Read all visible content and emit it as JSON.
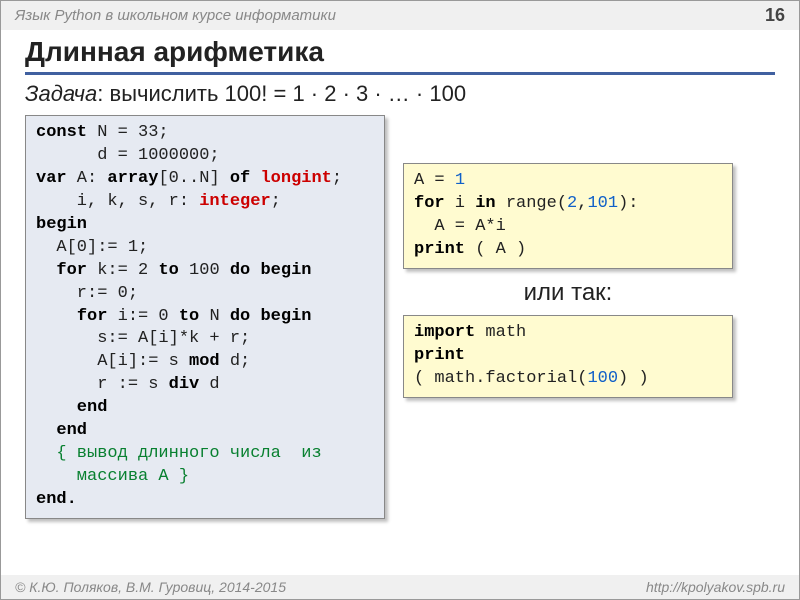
{
  "header": {
    "subject": "Язык Python в школьном курсе информатики",
    "page_num": "16"
  },
  "title": "Длинная арифметика",
  "task": {
    "label": "Задача",
    "text": ": вычислить 100! = 1 · 2 · 3  · … · 100"
  },
  "pascal": {
    "l1a": "const",
    "l1b": " N = 33;",
    "l2": "      d = 1000000;",
    "l3a": "var",
    "l3b": " A: ",
    "l3c": "array",
    "l3d": "[0..N] ",
    "l3e": "of",
    "l3f": " ",
    "l3g": "longint",
    "l3h": ";",
    "l4a": "    i, k, s, r: ",
    "l4b": "integer",
    "l4c": ";",
    "l5": "begin",
    "l6": "  A[0]:= 1;",
    "l7a": "  ",
    "l7b": "for",
    "l7c": " k:= 2 ",
    "l7d": "to",
    "l7e": " 100 ",
    "l7f": "do begin",
    "l8": "    r:= 0;",
    "l9a": "    ",
    "l9b": "for",
    "l9c": " i:= 0 ",
    "l9d": "to",
    "l9e": " N ",
    "l9f": "do begin",
    "l10": "      s:= A[i]*k + r;",
    "l11a": "      A[i]:= s ",
    "l11b": "mod",
    "l11c": " d;",
    "l12a": "      r := s ",
    "l12b": "div",
    "l12c": " d",
    "l13": "    end",
    "l14": "  end",
    "l15": "  { вывод длинного числа  из\n    массива A }",
    "l16": "end."
  },
  "python1": {
    "l1a": "A = ",
    "l1b": "1",
    "l2a": "for",
    "l2b": " i ",
    "l2c": "in",
    "l2d": " range(",
    "l2e": "2",
    "l2f": ",",
    "l2g": "101",
    "l2h": "):",
    "l3": "  A = A*i",
    "l4a": "print",
    "l4b": " ( A )"
  },
  "or_text": "или так:",
  "python2": {
    "l1a": "import",
    "l1b": " math",
    "l2": "print",
    "l3a": "( math.factorial(",
    "l3b": "100",
    "l3c": ") )"
  },
  "footer": {
    "authors": "© К.Ю. Поляков, В.М. Гуровиц, 2014-2015",
    "url": "http://kpolyakov.spb.ru"
  }
}
